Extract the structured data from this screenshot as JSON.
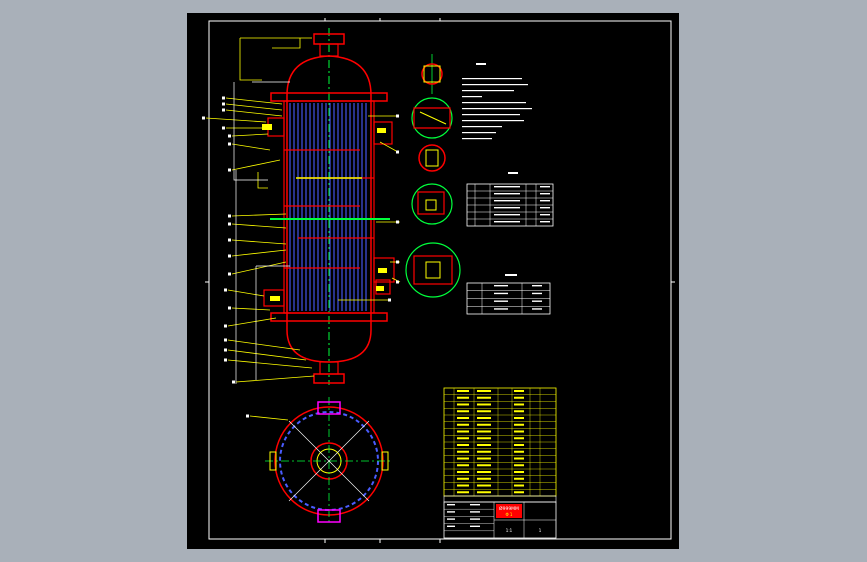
{
  "colors": {
    "background": "#a9b0b9",
    "sheet": "#000000",
    "frame": "#ffffff",
    "outline": "#ff0000",
    "tubes": "#4a5cff",
    "centerline": "#00ff3c",
    "leader": "#ffff00",
    "nozzle": "#ff00ff"
  },
  "title_block": {
    "stamp": "Ø999MM",
    "stamp2": "Φ 1",
    "scale": "1:1",
    "sheet": "1"
  },
  "tables": {
    "top_header": "技术",
    "mid_header": "管口",
    "bottom_header": "设计参数"
  }
}
